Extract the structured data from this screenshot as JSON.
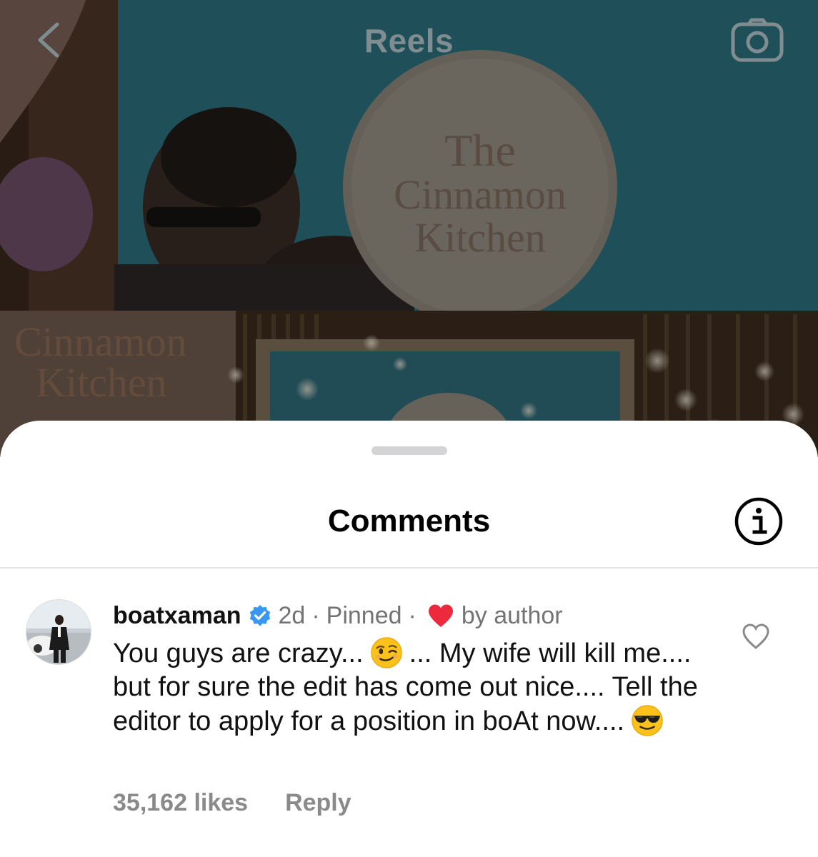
{
  "header": {
    "title": "Reels",
    "back_icon": "chevron-left-icon",
    "camera_icon": "camera-icon"
  },
  "video": {
    "sign_lines": [
      "The",
      "Cinnamon",
      "Kitchen"
    ],
    "sign_lines_lower": [
      "Cinnamon",
      "Kitchen"
    ]
  },
  "sheet": {
    "title": "Comments",
    "info_icon": "info-icon"
  },
  "comment": {
    "username": "boatxaman",
    "verified": true,
    "age": "2d",
    "separator": "·",
    "pinned": "Pinned",
    "by_author": "by author",
    "text_part1": "You guys are crazy...",
    "text_part2": "... My wife will kill me.... but for sure the edit has come out nice.... Tell the editor to apply for a position in boAt now....",
    "emoji_1": "winking-face",
    "emoji_2": "smiling-face-with-sunglasses",
    "likes": "35,162 likes",
    "reply": "Reply"
  },
  "colors": {
    "verified_blue": "#3897f0",
    "author_heart": "#ed2a3d",
    "muted_text": "#737373"
  }
}
